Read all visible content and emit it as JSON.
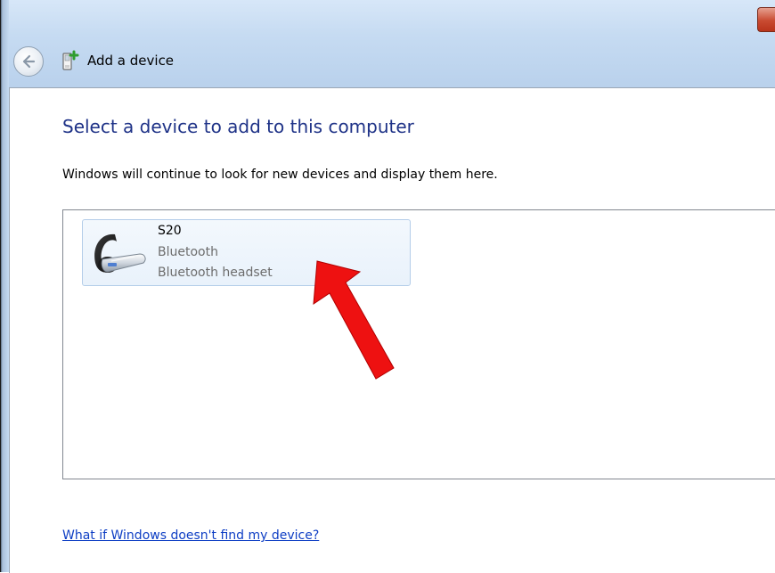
{
  "window": {
    "title": "Add a device"
  },
  "icons": {
    "back": "back-arrow-icon",
    "title": "add-device-icon",
    "device": "bluetooth-headset-icon",
    "annotation": "red-arrow-icon"
  },
  "main": {
    "heading": "Select a device to add to this computer",
    "description": "Windows will continue to look for new devices and display them here."
  },
  "devices": [
    {
      "name": "S20",
      "type": "Bluetooth",
      "category": "Bluetooth headset"
    }
  ],
  "footer": {
    "help_link": "What if Windows doesn't find my device?"
  },
  "colors": {
    "heading": "#1e3287",
    "link": "#0e3ec4",
    "annotation_arrow": "#ee1111",
    "selection_border": "#b4cde9"
  }
}
